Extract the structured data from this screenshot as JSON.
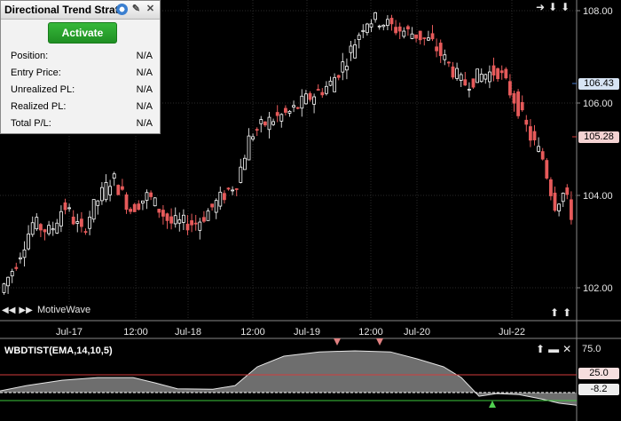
{
  "panel": {
    "title": "Directional Trend Strategy",
    "activate_label": "Activate",
    "rows": [
      {
        "label": "Position:",
        "value": "N/A"
      },
      {
        "label": "Entry Price:",
        "value": "N/A"
      },
      {
        "label": "Unrealized PL:",
        "value": "N/A"
      },
      {
        "label": "Realized PL:",
        "value": "N/A"
      },
      {
        "label": "Total P/L:",
        "value": "N/A"
      }
    ]
  },
  "watermark": "MotiveWave",
  "indicator": {
    "title": "WBDTIST(EMA,14,10,5)",
    "levels": [
      "75.0",
      "25.0",
      "-8.2"
    ]
  },
  "price_labels": {
    "current_blue": "106.43",
    "current_red": "105.28"
  },
  "chart_data": {
    "type": "candlestick",
    "y_axis_ticks": [
      "108.00",
      "106.00",
      "104.00",
      "102.00"
    ],
    "ylim": [
      101.7,
      108.3
    ],
    "x_ticks": [
      "Jul-17",
      "12:00",
      "Jul-18",
      "12:00",
      "Jul-19",
      "12:00",
      "Jul-20",
      "Jul-22"
    ],
    "indicator": {
      "upper_level": 25.0,
      "lower_level": -8.2,
      "axis_ticks": [
        "75.0"
      ]
    }
  },
  "colors": {
    "up": "#ffffff",
    "down": "#e65a5a",
    "red_line": "#d23c3c",
    "green_line": "#3cc83c"
  }
}
